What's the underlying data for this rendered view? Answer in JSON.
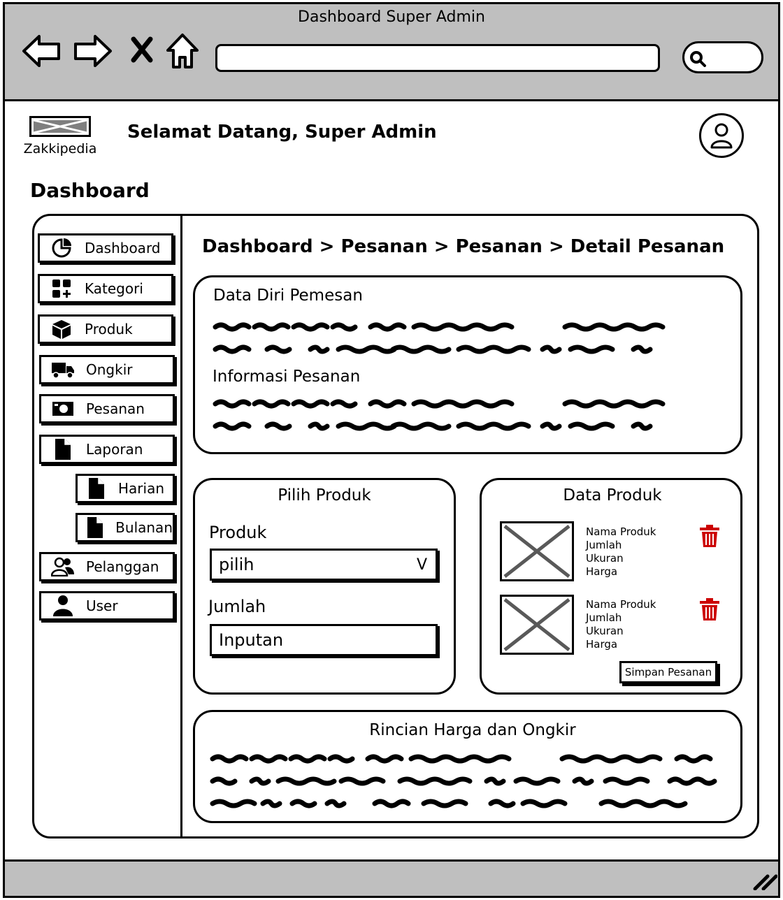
{
  "browser": {
    "title": "Dashboard Super Admin",
    "url": "",
    "search_icon": "search-icon"
  },
  "header": {
    "brand": "Zakkipedia",
    "welcome": "Selamat Datang, Super Admin",
    "avatar_icon": "user-icon"
  },
  "page": {
    "title": "Dashboard"
  },
  "sidebar": {
    "items": [
      {
        "label": "Dashboard",
        "icon": "pie-chart-icon"
      },
      {
        "label": "Kategori",
        "icon": "grid-plus-icon"
      },
      {
        "label": "Produk",
        "icon": "box-icon"
      },
      {
        "label": "Ongkir",
        "icon": "truck-icon"
      },
      {
        "label": "Pesanan",
        "icon": "cash-icon"
      },
      {
        "label": "Laporan",
        "icon": "file-icon"
      },
      {
        "label": "Harian",
        "icon": "file-icon"
      },
      {
        "label": "Bulanan",
        "icon": "file-icon"
      },
      {
        "label": "Pelanggan",
        "icon": "users-icon"
      },
      {
        "label": "User",
        "icon": "user-icon"
      }
    ]
  },
  "main": {
    "breadcrumb": "Dashboard > Pesanan > Pesanan > Detail Pesanan",
    "customer_panel": {
      "section1_title": "Data Diri Pemesan",
      "section2_title": "Informasi Pesanan"
    },
    "select_product": {
      "title": "Pilih Produk",
      "product_label": "Produk",
      "product_value": "pilih",
      "dropdown_glyph": "V",
      "qty_label": "Jumlah",
      "qty_value": "Inputan"
    },
    "product_data": {
      "title": "Data Produk",
      "items": [
        {
          "name": "Nama Produk",
          "qty": "Jumlah",
          "size": "Ukuran",
          "price": "Harga"
        },
        {
          "name": "Nama Produk",
          "qty": "Jumlah",
          "size": "Ukuran",
          "price": "Harga"
        }
      ],
      "save_label": "Simpan Pesanan"
    },
    "price_panel": {
      "title": "Rincian Harga dan Ongkir"
    }
  },
  "colors": {
    "chrome": "#bfbfbf",
    "danger": "#cc0000",
    "placeholder": "#595959"
  }
}
